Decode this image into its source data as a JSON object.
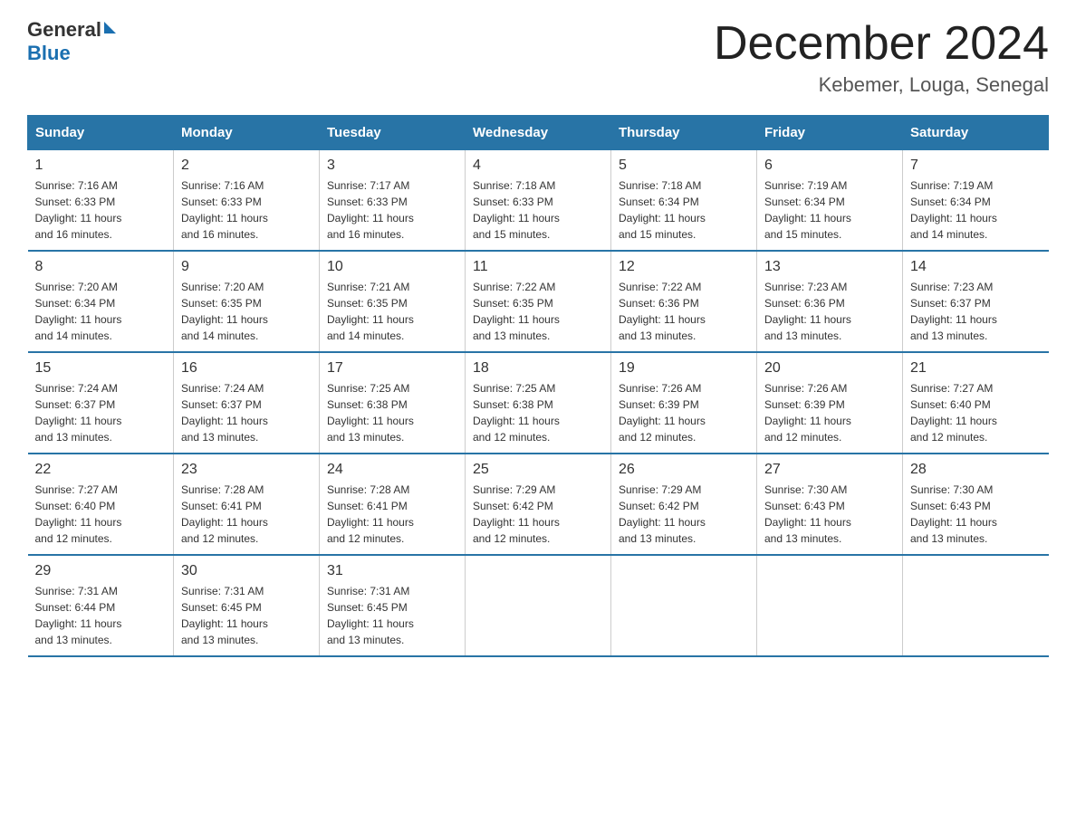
{
  "logo": {
    "text_general": "General",
    "text_blue": "Blue",
    "arrow_label": "generalblue-logo-arrow"
  },
  "header": {
    "title": "December 2024",
    "location": "Kebemer, Louga, Senegal"
  },
  "calendar": {
    "days_of_week": [
      "Sunday",
      "Monday",
      "Tuesday",
      "Wednesday",
      "Thursday",
      "Friday",
      "Saturday"
    ],
    "weeks": [
      [
        {
          "day": "1",
          "sunrise": "7:16 AM",
          "sunset": "6:33 PM",
          "daylight": "11 hours and 16 minutes."
        },
        {
          "day": "2",
          "sunrise": "7:16 AM",
          "sunset": "6:33 PM",
          "daylight": "11 hours and 16 minutes."
        },
        {
          "day": "3",
          "sunrise": "7:17 AM",
          "sunset": "6:33 PM",
          "daylight": "11 hours and 16 minutes."
        },
        {
          "day": "4",
          "sunrise": "7:18 AM",
          "sunset": "6:33 PM",
          "daylight": "11 hours and 15 minutes."
        },
        {
          "day": "5",
          "sunrise": "7:18 AM",
          "sunset": "6:34 PM",
          "daylight": "11 hours and 15 minutes."
        },
        {
          "day": "6",
          "sunrise": "7:19 AM",
          "sunset": "6:34 PM",
          "daylight": "11 hours and 15 minutes."
        },
        {
          "day": "7",
          "sunrise": "7:19 AM",
          "sunset": "6:34 PM",
          "daylight": "11 hours and 14 minutes."
        }
      ],
      [
        {
          "day": "8",
          "sunrise": "7:20 AM",
          "sunset": "6:34 PM",
          "daylight": "11 hours and 14 minutes."
        },
        {
          "day": "9",
          "sunrise": "7:20 AM",
          "sunset": "6:35 PM",
          "daylight": "11 hours and 14 minutes."
        },
        {
          "day": "10",
          "sunrise": "7:21 AM",
          "sunset": "6:35 PM",
          "daylight": "11 hours and 14 minutes."
        },
        {
          "day": "11",
          "sunrise": "7:22 AM",
          "sunset": "6:35 PM",
          "daylight": "11 hours and 13 minutes."
        },
        {
          "day": "12",
          "sunrise": "7:22 AM",
          "sunset": "6:36 PM",
          "daylight": "11 hours and 13 minutes."
        },
        {
          "day": "13",
          "sunrise": "7:23 AM",
          "sunset": "6:36 PM",
          "daylight": "11 hours and 13 minutes."
        },
        {
          "day": "14",
          "sunrise": "7:23 AM",
          "sunset": "6:37 PM",
          "daylight": "11 hours and 13 minutes."
        }
      ],
      [
        {
          "day": "15",
          "sunrise": "7:24 AM",
          "sunset": "6:37 PM",
          "daylight": "11 hours and 13 minutes."
        },
        {
          "day": "16",
          "sunrise": "7:24 AM",
          "sunset": "6:37 PM",
          "daylight": "11 hours and 13 minutes."
        },
        {
          "day": "17",
          "sunrise": "7:25 AM",
          "sunset": "6:38 PM",
          "daylight": "11 hours and 13 minutes."
        },
        {
          "day": "18",
          "sunrise": "7:25 AM",
          "sunset": "6:38 PM",
          "daylight": "11 hours and 12 minutes."
        },
        {
          "day": "19",
          "sunrise": "7:26 AM",
          "sunset": "6:39 PM",
          "daylight": "11 hours and 12 minutes."
        },
        {
          "day": "20",
          "sunrise": "7:26 AM",
          "sunset": "6:39 PM",
          "daylight": "11 hours and 12 minutes."
        },
        {
          "day": "21",
          "sunrise": "7:27 AM",
          "sunset": "6:40 PM",
          "daylight": "11 hours and 12 minutes."
        }
      ],
      [
        {
          "day": "22",
          "sunrise": "7:27 AM",
          "sunset": "6:40 PM",
          "daylight": "11 hours and 12 minutes."
        },
        {
          "day": "23",
          "sunrise": "7:28 AM",
          "sunset": "6:41 PM",
          "daylight": "11 hours and 12 minutes."
        },
        {
          "day": "24",
          "sunrise": "7:28 AM",
          "sunset": "6:41 PM",
          "daylight": "11 hours and 12 minutes."
        },
        {
          "day": "25",
          "sunrise": "7:29 AM",
          "sunset": "6:42 PM",
          "daylight": "11 hours and 12 minutes."
        },
        {
          "day": "26",
          "sunrise": "7:29 AM",
          "sunset": "6:42 PM",
          "daylight": "11 hours and 13 minutes."
        },
        {
          "day": "27",
          "sunrise": "7:30 AM",
          "sunset": "6:43 PM",
          "daylight": "11 hours and 13 minutes."
        },
        {
          "day": "28",
          "sunrise": "7:30 AM",
          "sunset": "6:43 PM",
          "daylight": "11 hours and 13 minutes."
        }
      ],
      [
        {
          "day": "29",
          "sunrise": "7:31 AM",
          "sunset": "6:44 PM",
          "daylight": "11 hours and 13 minutes."
        },
        {
          "day": "30",
          "sunrise": "7:31 AM",
          "sunset": "6:45 PM",
          "daylight": "11 hours and 13 minutes."
        },
        {
          "day": "31",
          "sunrise": "7:31 AM",
          "sunset": "6:45 PM",
          "daylight": "11 hours and 13 minutes."
        },
        null,
        null,
        null,
        null
      ]
    ],
    "labels": {
      "sunrise": "Sunrise:",
      "sunset": "Sunset:",
      "daylight": "Daylight:"
    }
  }
}
